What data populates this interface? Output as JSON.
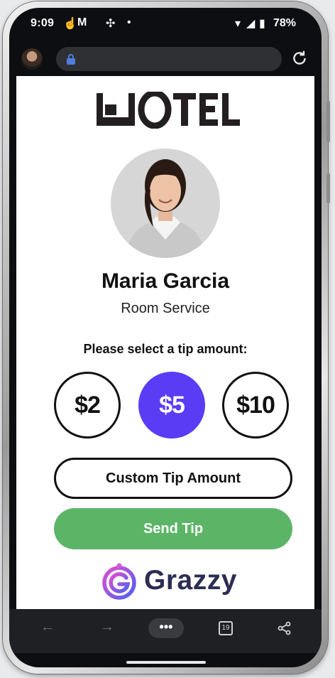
{
  "status_bar": {
    "time": "9:09",
    "battery": "78%"
  },
  "browser": {
    "url": ""
  },
  "hotel": {
    "logo_text": "HOTEL"
  },
  "staff": {
    "name": "Maria Garcia",
    "role": "Room Service"
  },
  "tip": {
    "prompt": "Please select a tip amount:",
    "options": [
      "$2",
      "$5",
      "$10"
    ],
    "selected": "$5",
    "custom_label": "Custom Tip Amount",
    "send_label": "Send Tip"
  },
  "brand": {
    "name": "Grazzy"
  },
  "bottom_nav": {
    "tab_count": "19"
  },
  "colors": {
    "accent": "#5b3cf5",
    "send": "#5cb567",
    "brand_text": "#2b2d52"
  }
}
